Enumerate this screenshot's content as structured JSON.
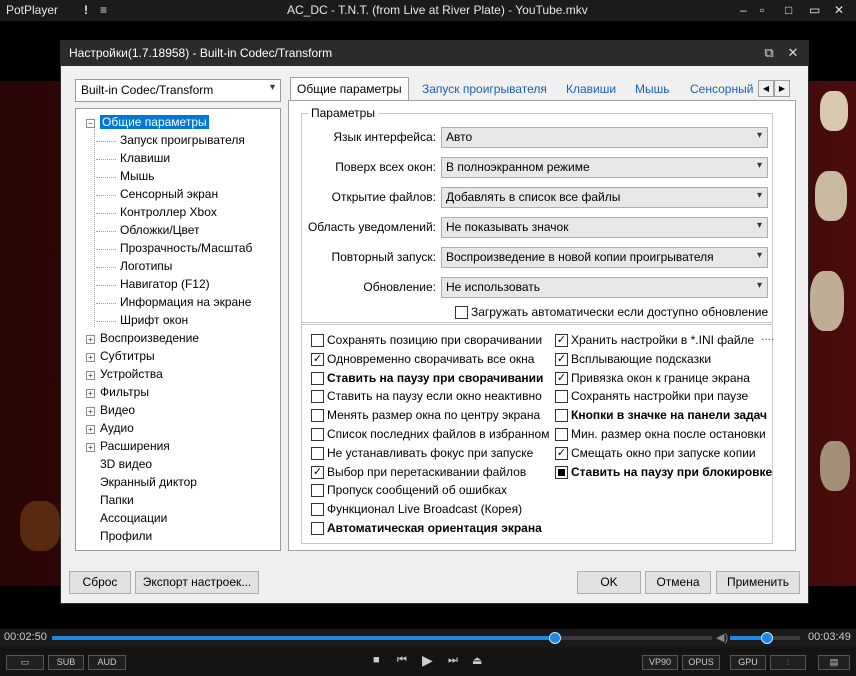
{
  "player": {
    "app_name": "PotPlayer",
    "file_title": "AC_DC - T.N.T. (from Live at River Plate) - YouTube.mkv",
    "time_elapsed": "00:02:50",
    "time_total": "00:03:49",
    "progress": 0.76,
    "volume": 0.52,
    "btn_sub": "SUB",
    "btn_aud": "AUD",
    "codec1": "VP90",
    "codec2": "OPUS",
    "gpu": "GPU"
  },
  "dialog": {
    "title": "Настройки(1.7.18958) - Built-in Codec/Transform",
    "preset_combo": "Built-in Codec/Transform",
    "tree": [
      {
        "label": "Общие параметры",
        "level": 0,
        "expanded": true,
        "selected": true
      },
      {
        "label": "Запуск проигрывателя",
        "level": 1
      },
      {
        "label": "Клавиши",
        "level": 1
      },
      {
        "label": "Мышь",
        "level": 1
      },
      {
        "label": "Сенсорный экран",
        "level": 1
      },
      {
        "label": "Контроллер Xbox",
        "level": 1
      },
      {
        "label": "Обложки/Цвет",
        "level": 1
      },
      {
        "label": "Прозрачность/Масштаб",
        "level": 1
      },
      {
        "label": "Логотипы",
        "level": 1
      },
      {
        "label": "Навигатор (F12)",
        "level": 1
      },
      {
        "label": "Информация на экране",
        "level": 1
      },
      {
        "label": "Шрифт окон",
        "level": 1
      },
      {
        "label": "Воспроизведение",
        "level": 0,
        "expanded": false
      },
      {
        "label": "Субтитры",
        "level": 0,
        "expanded": false
      },
      {
        "label": "Устройства",
        "level": 0,
        "expanded": false
      },
      {
        "label": "Фильтры",
        "level": 0,
        "expanded": false
      },
      {
        "label": "Видео",
        "level": 0,
        "expanded": false
      },
      {
        "label": "Аудио",
        "level": 0,
        "expanded": false
      },
      {
        "label": "Расширения",
        "level": 0,
        "expanded": false
      },
      {
        "label": "3D видео",
        "level": 0
      },
      {
        "label": "Экранный диктор",
        "level": 0
      },
      {
        "label": "Папки",
        "level": 0
      },
      {
        "label": "Ассоциации",
        "level": 0
      },
      {
        "label": "Профили",
        "level": 0
      }
    ],
    "tabs": [
      "Общие параметры",
      "Запуск проигрывателя",
      "Клавиши",
      "Мышь",
      "Сенсорный"
    ],
    "group_title": "Параметры",
    "settings": [
      {
        "label": "Язык интерфейса:",
        "value": "Авто"
      },
      {
        "label": "Поверх всех окон:",
        "value": "В полноэкранном режиме"
      },
      {
        "label": "Открытие файлов:",
        "value": "Добавлять в список все файлы"
      },
      {
        "label": "Область уведомлений:",
        "value": "Не показывать значок"
      },
      {
        "label": "Повторный запуск:",
        "value": "Воспроизведение в новой копии проигрывателя"
      },
      {
        "label": "Обновление:",
        "value": "Не использовать"
      }
    ],
    "auto_update": {
      "label": "Загружать автоматически если доступно обновление",
      "checked": false
    },
    "checks_left": [
      {
        "label": "Сохранять позицию при сворачивании",
        "checked": false,
        "bold": false
      },
      {
        "label": "Одновременно сворачивать все окна",
        "checked": true,
        "bold": false
      },
      {
        "label": "Ставить на паузу при сворачивании",
        "checked": false,
        "bold": true
      },
      {
        "label": "Ставить на паузу если окно неактивно",
        "checked": false,
        "bold": false
      },
      {
        "label": "Менять размер окна по центру экрана",
        "checked": false,
        "bold": false
      },
      {
        "label": "Список последних файлов в избранном",
        "checked": false,
        "bold": false
      },
      {
        "label": "Не устанавливать фокус при запуске",
        "checked": false,
        "bold": false
      },
      {
        "label": "Выбор при перетаскивании файлов",
        "checked": true,
        "bold": false
      },
      {
        "label": "Пропуск сообщений об ошибках",
        "checked": false,
        "bold": false
      },
      {
        "label": "Функционал Live Broadcast (Корея)",
        "checked": false,
        "bold": false
      },
      {
        "label": "Автоматическая ориентация экрана",
        "checked": false,
        "bold": true
      }
    ],
    "checks_right": [
      {
        "label": "Хранить настройки в *.INI файле",
        "checked": true,
        "bold": false
      },
      {
        "label": "Всплывающие подсказки",
        "checked": true,
        "bold": false
      },
      {
        "label": "Привязка окон к границе экрана",
        "checked": true,
        "bold": false
      },
      {
        "label": "Сохранять настройки при паузе",
        "checked": false,
        "bold": false
      },
      {
        "label": "Кнопки в значке на панели задач",
        "checked": false,
        "bold": true
      },
      {
        "label": "Мин. размер окна после остановки",
        "checked": false,
        "bold": false
      },
      {
        "label": "Смещать окно при запуске копии",
        "checked": true,
        "bold": false
      },
      {
        "label": "Ставить на паузу при блокировке",
        "checked": "indeterminate",
        "bold": true
      }
    ],
    "ini_more": "....",
    "btn_reset": "Сброс",
    "btn_export": "Экспорт настроек...",
    "btn_ok": "OK",
    "btn_cancel": "Отмена",
    "btn_apply": "Применить"
  }
}
